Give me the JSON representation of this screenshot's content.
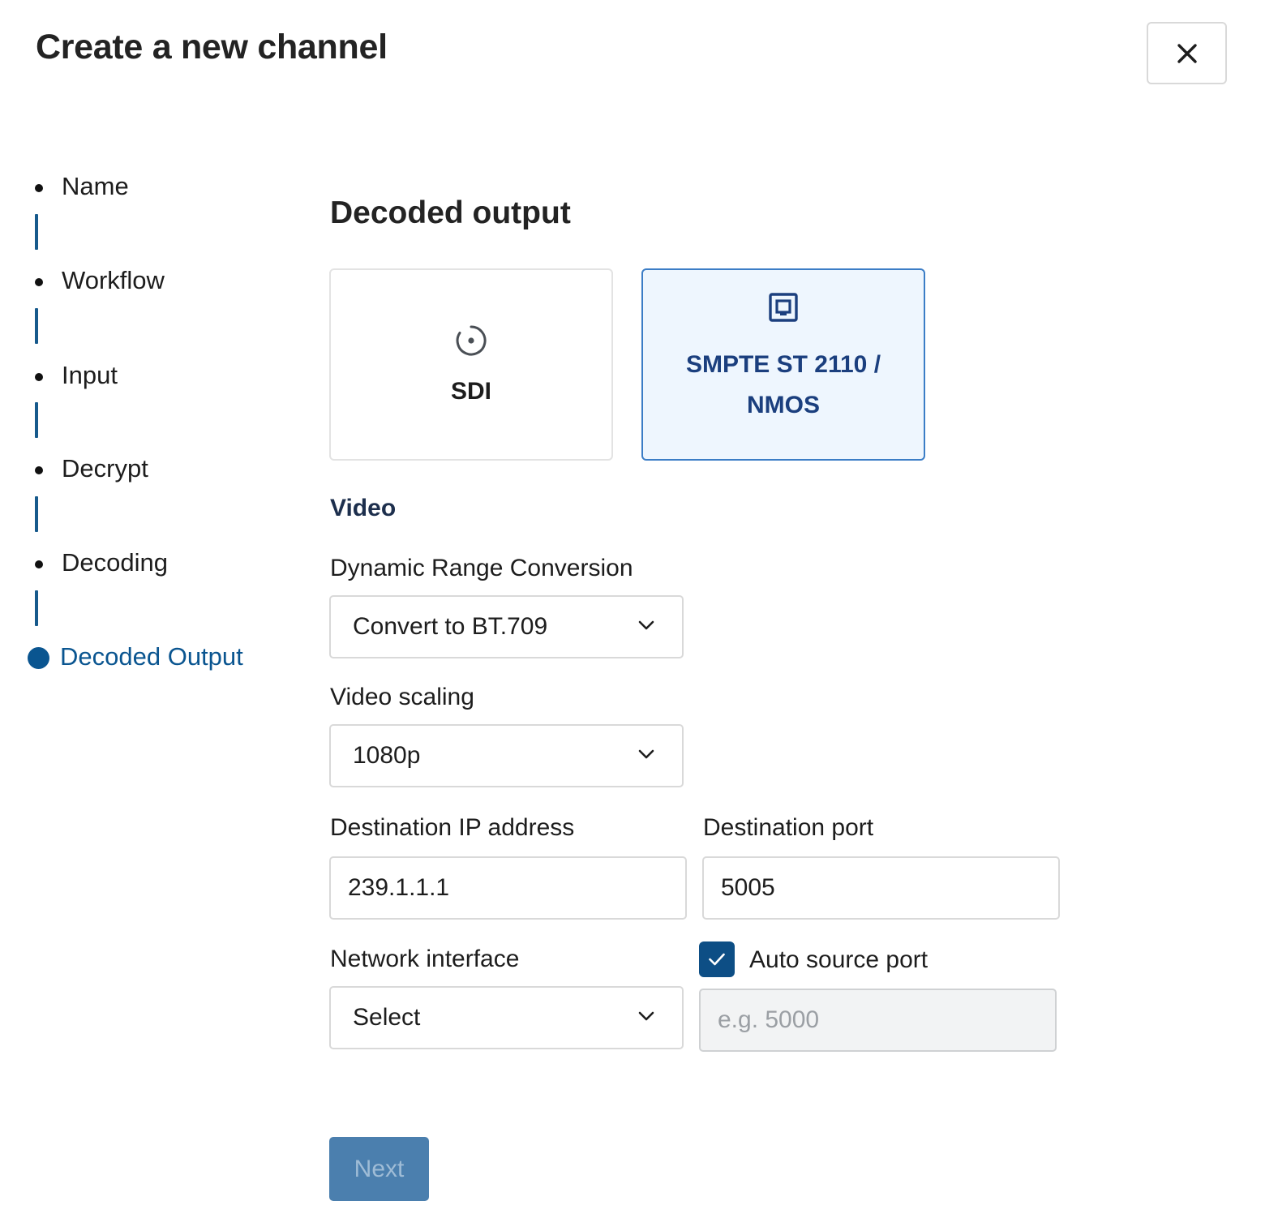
{
  "dialog": {
    "title": "Create a new channel",
    "close_icon": "close-icon"
  },
  "stepper": {
    "steps": [
      {
        "label": "Name",
        "state": "done"
      },
      {
        "label": "Workflow",
        "state": "done"
      },
      {
        "label": "Input",
        "state": "done"
      },
      {
        "label": "Decrypt",
        "state": "done"
      },
      {
        "label": "Decoding",
        "state": "done"
      },
      {
        "label": "Decoded Output",
        "state": "active"
      }
    ],
    "accent_color": "#0a5590"
  },
  "section": {
    "title": "Decoded output"
  },
  "output_types": {
    "options": [
      {
        "label": "SDI",
        "icon": "radio-target-icon",
        "selected": false
      },
      {
        "label": "SMPTE ST 2110 / NMOS",
        "icon": "network-port-icon",
        "selected": true
      }
    ]
  },
  "video": {
    "title": "Video",
    "dynamic_range": {
      "label": "Dynamic Range Conversion",
      "value": "Convert to BT.709"
    },
    "scaling": {
      "label": "Video scaling",
      "value": "1080p"
    },
    "destination_ip": {
      "label": "Destination IP address",
      "value": "239.1.1.1"
    },
    "destination_port": {
      "label": "Destination port",
      "value": "5005"
    },
    "network_interface": {
      "label": "Network interface",
      "value": "Select"
    },
    "auto_source_port": {
      "label": "Auto source port",
      "checked": true,
      "placeholder": "e.g. 5000"
    }
  },
  "actions": {
    "next_label": "Next"
  },
  "colors": {
    "primary": "#0d4e85",
    "selected_card_border": "#3b7dc6",
    "selected_card_bg": "#eef6fe",
    "next_button_bg": "#4b7fae"
  }
}
